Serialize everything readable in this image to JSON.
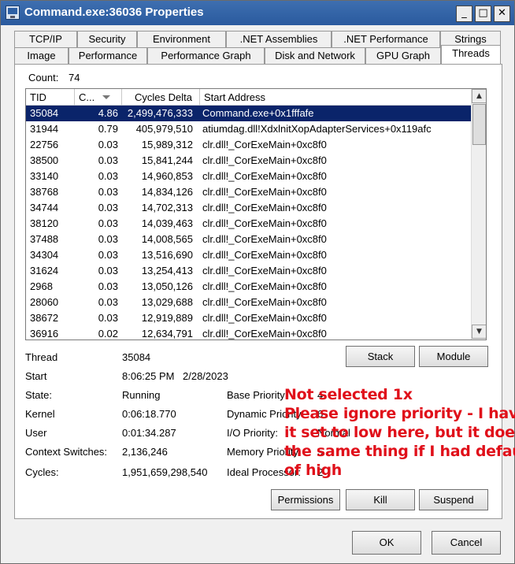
{
  "window": {
    "title": "Command.exe:36036 Properties"
  },
  "caption_buttons": {
    "minimize": "_",
    "maximize": "□",
    "close": "✕"
  },
  "tabs": {
    "row1": [
      "TCP/IP",
      "Security",
      "Environment",
      ".NET Assemblies",
      ".NET Performance",
      "Strings"
    ],
    "row2": [
      "Image",
      "Performance",
      "Performance Graph",
      "Disk and Network",
      "GPU Graph",
      "Threads"
    ],
    "active": "Threads"
  },
  "threads": {
    "count_label": "Count:",
    "count_value": "74",
    "columns": [
      "TID",
      "C...",
      "Cycles Delta",
      "Start Address"
    ],
    "rows": [
      [
        "35084",
        "4.86",
        "2,499,476,333",
        "Command.exe+0x1fffafe"
      ],
      [
        "31944",
        "0.79",
        "405,979,510",
        "atiumdag.dll!XdxlnitXopAdapterServices+0x119afc"
      ],
      [
        "22756",
        "0.03",
        "15,989,312",
        "clr.dll!_CorExeMain+0xc8f0"
      ],
      [
        "38500",
        "0.03",
        "15,841,244",
        "clr.dll!_CorExeMain+0xc8f0"
      ],
      [
        "33140",
        "0.03",
        "14,960,853",
        "clr.dll!_CorExeMain+0xc8f0"
      ],
      [
        "38768",
        "0.03",
        "14,834,126",
        "clr.dll!_CorExeMain+0xc8f0"
      ],
      [
        "34744",
        "0.03",
        "14,702,313",
        "clr.dll!_CorExeMain+0xc8f0"
      ],
      [
        "38120",
        "0.03",
        "14,039,463",
        "clr.dll!_CorExeMain+0xc8f0"
      ],
      [
        "37488",
        "0.03",
        "14,008,565",
        "clr.dll!_CorExeMain+0xc8f0"
      ],
      [
        "34304",
        "0.03",
        "13,516,690",
        "clr.dll!_CorExeMain+0xc8f0"
      ],
      [
        "31624",
        "0.03",
        "13,254,413",
        "clr.dll!_CorExeMain+0xc8f0"
      ],
      [
        "2968",
        "0.03",
        "13,050,126",
        "clr.dll!_CorExeMain+0xc8f0"
      ],
      [
        "28060",
        "0.03",
        "13,029,688",
        "clr.dll!_CorExeMain+0xc8f0"
      ],
      [
        "38672",
        "0.03",
        "12,919,889",
        "clr.dll!_CorExeMain+0xc8f0"
      ],
      [
        "36916",
        "0.02",
        "12,634,791",
        "clr.dll!_CorExeMain+0xc8f0"
      ]
    ],
    "selected_index": 0
  },
  "details": {
    "thread_label": "Thread",
    "thread_value": "35084",
    "start_label": "Start",
    "start_time": "8:06:25 PM",
    "start_date": "2/28/2023",
    "state_label": "State:",
    "state_value": "Running",
    "kernel_label": "Kernel",
    "kernel_value": "0:06:18.770",
    "user_label": "User",
    "user_value": "0:01:34.287",
    "ctx_label": "Context Switches:",
    "ctx_value": "2,136,246",
    "cycles_label": "Cycles:",
    "cycles_value": "1,951,659,298,540",
    "base_priority_label": "Base Priority:",
    "base_priority_value": "4",
    "dynamic_priority_label": "Dynamic Priority:",
    "dynamic_priority_value": "6",
    "io_priority_label": "I/O Priority:",
    "io_priority_value": "Normal",
    "memory_priority_label": "Memory Priority:",
    "memory_priority_value": "5",
    "ideal_processor_label": "Ideal Processor:",
    "ideal_processor_value": "2"
  },
  "buttons": {
    "stack": "Stack",
    "module": "Module",
    "permissions": "Permissions",
    "kill": "Kill",
    "suspend": "Suspend",
    "ok": "OK",
    "cancel": "Cancel"
  },
  "annotation": {
    "color": "#e0101a",
    "lines": [
      "Not selected 1x",
      "Please ignore priority - I have",
      "it set to low here, but it does",
      "the same thing if I had default",
      "of high"
    ]
  },
  "colors": {
    "selection": "#0a246a",
    "titlebar": "#2a5a9e"
  }
}
